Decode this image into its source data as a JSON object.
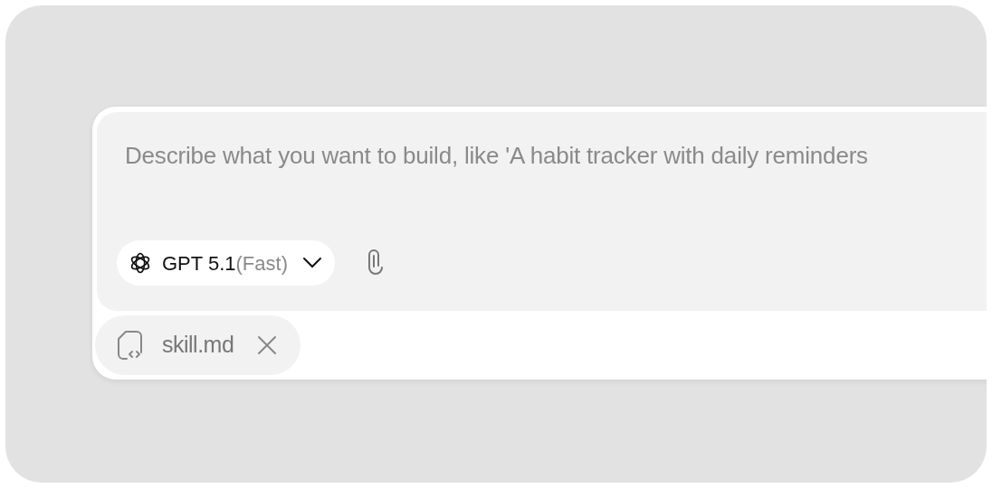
{
  "prompt": {
    "placeholder": "Describe what you want to build, like 'A habit tracker with daily reminders"
  },
  "model_picker": {
    "name": "GPT 5.1",
    "mode": "(Fast)"
  },
  "attachments": [
    {
      "name": "skill.md"
    }
  ]
}
